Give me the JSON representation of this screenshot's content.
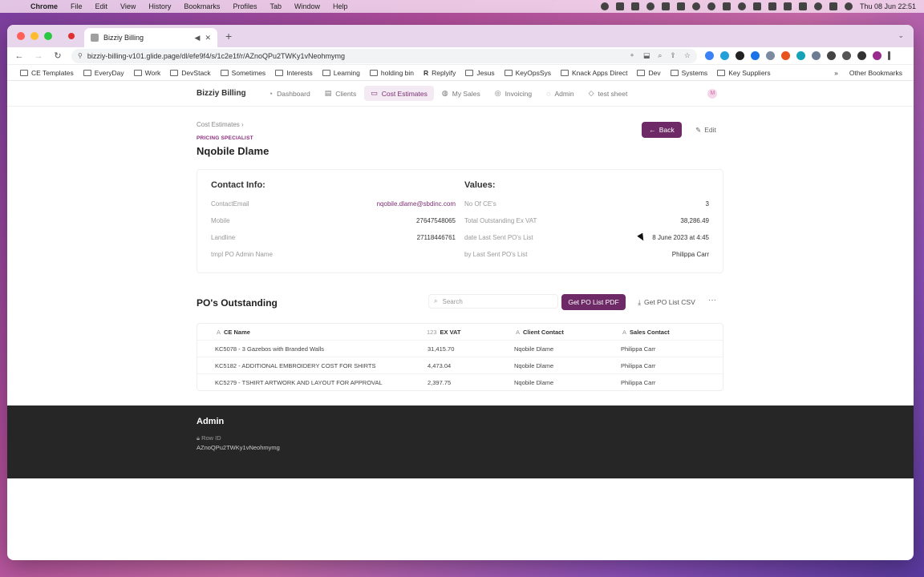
{
  "menubar": {
    "app": "Chrome",
    "items": [
      "File",
      "Edit",
      "View",
      "History",
      "Bookmarks",
      "Profiles",
      "Tab",
      "Window",
      "Help"
    ],
    "clock": "Thu 08 Jun  22:51"
  },
  "browser": {
    "tab_title": "Bizziy Billing",
    "url": "bizziy-billing-v101.glide.page/dl/efe9f4/s/1c2e1f/r/AZnoQPu2TWKy1vNeohmymg",
    "bookmarks": [
      "CE Templates",
      "EveryDay",
      "Work",
      "DevStack",
      "Sometimes",
      "Interests",
      "Learning",
      "holding bin",
      "Replyify",
      "Jesus",
      "KeyOpsSys",
      "Knack Apps Direct",
      "Dev",
      "Systems",
      "Key Suppliers"
    ],
    "bookmarks_more": "»",
    "other_bookmarks": "Other Bookmarks"
  },
  "app": {
    "brand": "Bizziy Billing",
    "nav": [
      {
        "label": "Dashboard",
        "icon": "gauge-icon"
      },
      {
        "label": "Clients",
        "icon": "document-icon"
      },
      {
        "label": "Cost Estimates",
        "icon": "inbox-icon",
        "active": true
      },
      {
        "label": "My Sales",
        "icon": "globe-icon"
      },
      {
        "label": "Invoicing",
        "icon": "stack-icon"
      },
      {
        "label": "Admin",
        "icon": "chat-icon"
      },
      {
        "label": "test sheet",
        "icon": "tag-icon"
      }
    ],
    "avatar_initial": "M"
  },
  "page": {
    "breadcrumb": "Cost Estimates  ›",
    "overline": "PRICING SPECIALIST",
    "title": "Nqobile Dlame",
    "back_label": "Back",
    "edit_label": "Edit"
  },
  "contact": {
    "heading": "Contact Info:",
    "rows": [
      {
        "key": "ContactEmail",
        "value": "nqobile.dlame@sbdinc.com"
      },
      {
        "key": "Mobile",
        "value": "27647548065"
      },
      {
        "key": "Landline",
        "value": "27118446761"
      },
      {
        "key": "tmpl PO Admin Name",
        "value": ""
      }
    ]
  },
  "values": {
    "heading": "Values:",
    "rows": [
      {
        "key": "No Of CE's",
        "value": "3"
      },
      {
        "key": "Total Outstanding Ex VAT",
        "value": "38,286.49"
      },
      {
        "key": "date Last Sent PO's List",
        "value": "8 June 2023 at 4:45"
      },
      {
        "key": "by Last Sent PO's List",
        "value": "Philippa Carr"
      }
    ]
  },
  "po": {
    "title": "PO's Outstanding",
    "search_placeholder": "Search",
    "pdf_label": "Get PO List PDF",
    "csv_label": "Get PO List CSV",
    "more_label": "···",
    "columns": [
      "CE Name",
      "EX VAT",
      "Client Contact",
      "Sales Contact"
    ],
    "rows": [
      {
        "ce_name": "KC5078 - 3 Gazebos with Branded Walls",
        "ex_vat": "31,415.70",
        "client": "Nqobile Dlame",
        "sales": "Philippa Carr"
      },
      {
        "ce_name": "KC5182 - ADDITIONAL EMBROIDERY COST FOR SHIRTS",
        "ex_vat": "4,473.04",
        "client": "Nqobile Dlame",
        "sales": "Philippa Carr"
      },
      {
        "ce_name": "KC5279 - TSHIRT ARTWORK AND LAYOUT FOR APPROVAL",
        "ex_vat": "2,397.75",
        "client": "Nqobile Dlame",
        "sales": "Philippa Carr"
      }
    ]
  },
  "admin": {
    "title": "Admin",
    "row_id_label": "Row ID",
    "row_id_value": "AZnoQPu2TWKy1vNeohmymg"
  },
  "colors": {
    "accent": "#6d2a66",
    "footer": "#262626"
  }
}
